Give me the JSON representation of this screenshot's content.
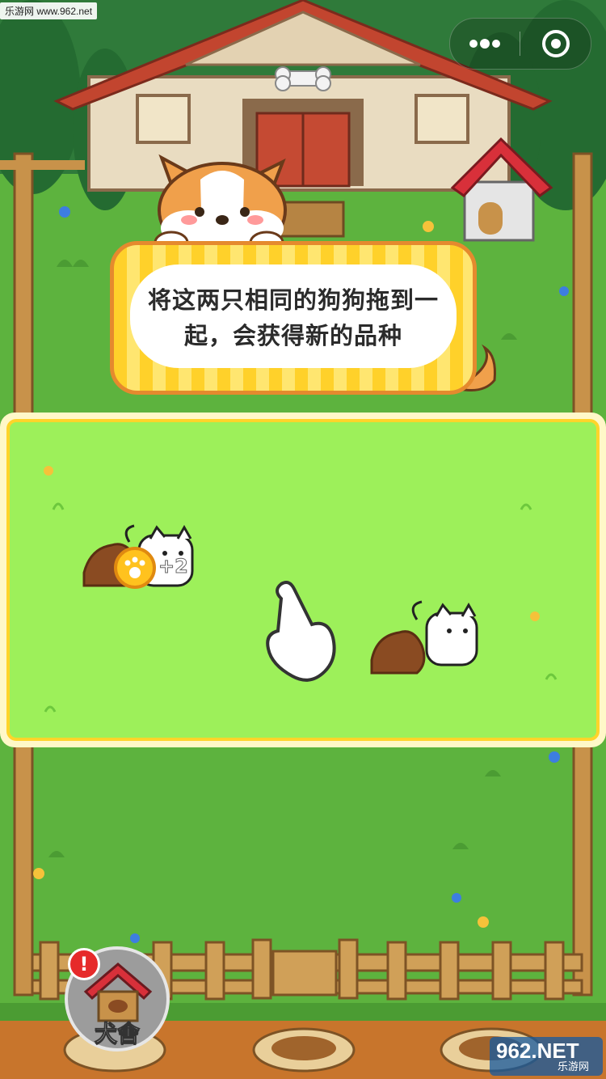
{
  "watermark_top": "乐游网 www.962.net",
  "capsule": {
    "more_icon": "more-dots-icon",
    "close_icon": "target-close-icon"
  },
  "tooltip": {
    "text": "将这两只相同的狗狗拖到一起，会获得新的品种"
  },
  "play_area": {
    "coin_bonus": "+2"
  },
  "kennel": {
    "label": "犬舍",
    "alert": "!"
  },
  "watermark_bottom": {
    "main": "962.NET",
    "sub": "乐游网"
  },
  "colors": {
    "lawn": "#5db33e",
    "play_area": "#9df05a",
    "tooltip_border": "#e58a2e",
    "tooltip_fill": "#ffd12a",
    "frame": "#ffd42a"
  }
}
